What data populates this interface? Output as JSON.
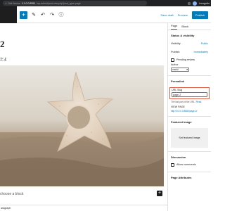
{
  "browser": {
    "security_label": "Not Secure",
    "url_host": "0.0.0.0:8080",
    "url_path": "/wp-admin/post-new.php?post_type=page",
    "profile_label": "Incognito"
  },
  "toolbar": {
    "add_block_symbol": "+",
    "save_draft_label": "Save draft",
    "preview_label": "Preview",
    "publish_label": "Publish"
  },
  "content": {
    "title": "2",
    "paragraph": "だよ",
    "block_placeholder": "choose a block",
    "inline_add_symbol": "+",
    "breadcrumb": "aragraph"
  },
  "sidebar": {
    "tabs": [
      "Page",
      "Block"
    ],
    "status_title": "Status & visibility",
    "visibility_label": "Visibility",
    "visibility_value": "Public",
    "publish_label": "Publish",
    "publish_value": "Immediately",
    "pending_review_label": "Pending review",
    "author_label": "Author",
    "author_value": "vswhl",
    "permalink_title": "Permalink",
    "url_slug_label": "URL Slug",
    "url_slug_value": "page-2",
    "slug_help_text": "The last part of the URL.",
    "slug_help_link": "Read",
    "view_page_label": "VIEW PAGE",
    "view_page_url": "http://0.0.0.0:8080/page-2/",
    "featured_image_title": "Featured image",
    "set_featured_label": "Set featured image",
    "discussion_title": "Discussion",
    "allow_comments_label": "Allow comments",
    "page_attributes_title": "Page Attributes"
  },
  "colors": {
    "accent": "#007cba",
    "highlight_border": "#e25b44"
  },
  "icons": {
    "wp_logo": "wordpress-logo-icon",
    "tools": "pencil-icon",
    "undo": "undo-icon",
    "redo": "redo-icon",
    "details": "info-icon"
  }
}
